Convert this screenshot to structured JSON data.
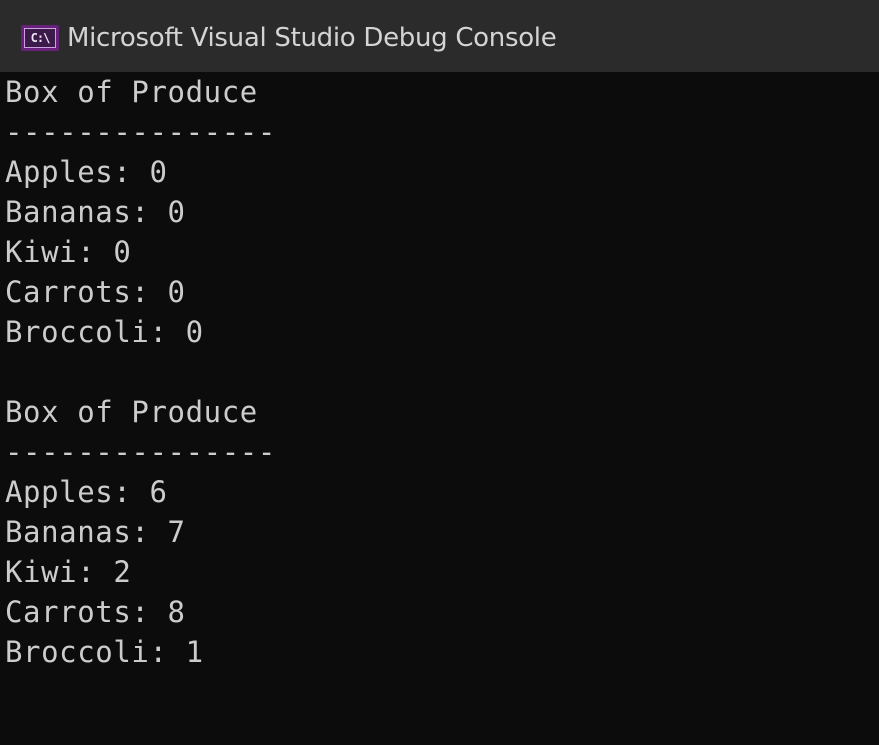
{
  "window": {
    "title": "Microsoft Visual Studio Debug Console",
    "icon": "console-app-icon",
    "icon_glyph": "C:\\",
    "colors": {
      "titlebar": "#2b2b2b",
      "background": "#0c0c0c",
      "text": "#cccccc",
      "icon_bg": "#68217a"
    }
  },
  "console": {
    "lines": [
      "Box of Produce",
      "---------------",
      "Apples: 0",
      "Bananas: 0",
      "Kiwi: 0",
      "Carrots: 0",
      "Broccoli: 0",
      "",
      "Box of Produce",
      "---------------",
      "Apples: 6",
      "Bananas: 7",
      "Kiwi: 2",
      "Carrots: 8",
      "Broccoli: 1"
    ]
  }
}
